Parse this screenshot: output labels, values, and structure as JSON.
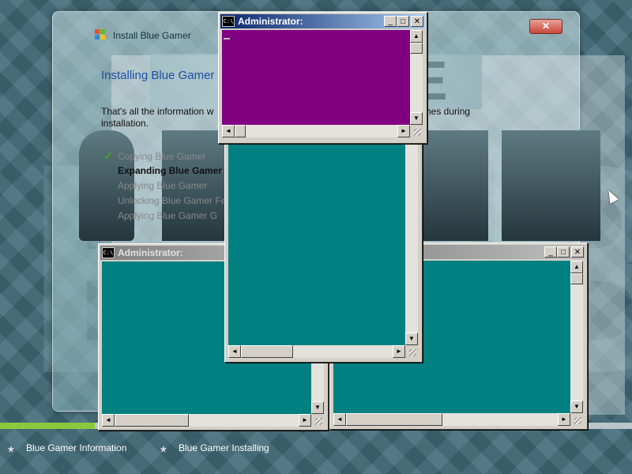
{
  "installer": {
    "title": "Install Blue Gamer",
    "close_label": "✕",
    "heading": "Installing Blue Gamer",
    "desc_left": "That's all the information w",
    "desc_left2": "installation.",
    "desc_right": "hes during",
    "steps": [
      {
        "label": "Copying Blue Gamer",
        "state": "done"
      },
      {
        "label": "Expanding Blue Gamer (",
        "state": "current"
      },
      {
        "label": "Applying Blue Gamer",
        "state": "pending"
      },
      {
        "label": "Unlocking Blue Gamer Fe",
        "state": "pending"
      },
      {
        "label": "Applying Blue Gamer G",
        "state": "pending"
      }
    ]
  },
  "progress": {
    "value_percent": 15
  },
  "footer": {
    "items": [
      "Blue Gamer Information",
      "Blue Gamer Installing"
    ]
  },
  "consoles": {
    "top": {
      "title": "Administrator:",
      "bg": "#800080"
    },
    "bottom_left": {
      "title": "Administrator:",
      "bg": "#008080"
    },
    "middle": {
      "title": "",
      "bg": "#008080"
    },
    "right": {
      "title": "",
      "bg": "#008080"
    }
  },
  "icons": {
    "console_icon": "C:\\",
    "minimize": "_",
    "maximize": "□",
    "close": "✕",
    "scroll_up": "▲",
    "scroll_down": "▼",
    "scroll_left": "◄",
    "scroll_right": "►"
  },
  "colors": {
    "progress_fill": "#8cc83c",
    "heading": "#1d4fa0",
    "title_active": "#0a246a"
  }
}
